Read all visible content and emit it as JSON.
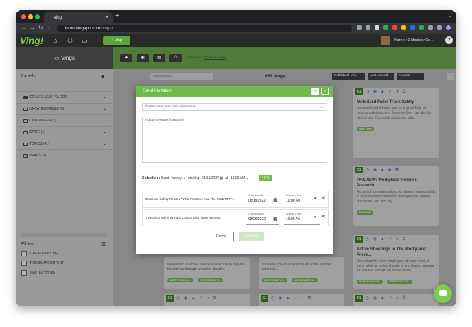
{
  "browser": {
    "tab_title": "Ving",
    "tab_close": "✕",
    "new_tab": "+",
    "url_host": "demo.vingapp.com",
    "url_path": "/vings/"
  },
  "appbar": {
    "logo": "Ving!",
    "new_ving_button": "+ Ving",
    "user_name": "Karen +1 Mastery Co...",
    "help": "?"
  },
  "subbar": {
    "vings_title": "Vings",
    "selected_text": "2 selected",
    "select_all": "Select all vings"
  },
  "sidebar": {
    "title": "Labels",
    "labels": [
      {
        "label": "CREATE NEW FOLDER"
      },
      {
        "label": "UNCATEGORIZED (3)"
      },
      {
        "label": "LANGUAGES (1)"
      },
      {
        "label": "STATE (1)"
      },
      {
        "label": "TOPICS (41)"
      },
      {
        "label": "YEARS (1)"
      }
    ],
    "filters_title": "Filters",
    "filters": [
      "CREATED BY ME",
      "PREMIUM CONTENT",
      "INVITED BY ME"
    ]
  },
  "main": {
    "search_placeholder": "Search vings...",
    "count": "651 vings",
    "filter_published": "Published - Ac...",
    "filter_sort": "Last Viewed",
    "filter_anyone": "Anyone"
  },
  "cards": [
    {
      "badge": "K1",
      "title": "Motorized Pallet Truck Safety",
      "desc": "Motorized pallet trucks can be a great help for moving pallets around, however they can also be dangerous. This training teaches safe...",
      "tags": [
        "NEW HIRE"
      ]
    },
    {
      "badge": "S1",
      "title": "PREVIEW: Workplace Violence Preventio...",
      "desc": "As part of an organization, you have a responsibility to report violent conduct to management, human resources, and security. I...",
      "tags": [
        "PREVIEW"
      ]
    },
    {
      "badge": "K1",
      "title": "Active Shootings In The Workplace: Preve...",
      "desc": "It is critical for every employee, at every level, to know what an active shooter is and how to prepare for and live through an active shooti...",
      "tags": [
        "WORKPLACE VI...",
        "EMERGENCY R..."
      ]
    },
    {
      "badge": "",
      "title": "",
      "desc": "know what an active shooter is and how to prepare for and live through an active shootin...",
      "tags": [
        "WORKPLACE VI...",
        "EMERGENCY R..."
      ]
    },
    {
      "badge": "",
      "title": "",
      "desc": "situation, how to respond to an active shooter situation,...",
      "tags": [
        "EMERGENCY R...",
        "WORKPLACE VI..."
      ]
    }
  ],
  "bottom_badges": [
    "K1",
    "K1",
    "K1"
  ],
  "modal": {
    "title": "Send Invitation",
    "recipients_placeholder": "Please enter 2 or more characters",
    "message_placeholder": "Add a message (Optional)",
    "schedule_label": "Schedule:",
    "send_text": "Send",
    "frequency": "weekly",
    "starting_text": "starting",
    "start_date": "08/19/2022",
    "at_text": "at",
    "start_time": "10:00 AM",
    "apply": "Apply",
    "rows": [
      {
        "course": "Electrical Safety Related Work Practices And The 2021 NFPA...",
        "date_label": "Choose a date",
        "date": "08/19/2022",
        "time_label": "Choose a time",
        "time": "10:00 AM"
      },
      {
        "course": "Trenching and Shoring in Construction Environments",
        "date_label": "Choose a date",
        "date": "08/26/2022",
        "time_label": "Choose a time",
        "time": "10:00 AM"
      }
    ],
    "cancel": "Cancel",
    "schedule_button": "Schedule"
  },
  "colors": {
    "brand_green": "#6dbb4d",
    "dark_green": "#4f7a3c",
    "icon_blue": "#2a5788"
  }
}
